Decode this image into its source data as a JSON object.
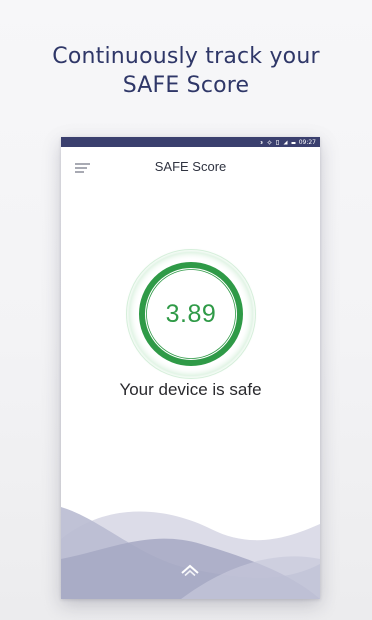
{
  "headline": {
    "line1": "Continuously track your",
    "line2": "SAFE Score"
  },
  "statusbar": {
    "time": "09:27"
  },
  "appbar": {
    "title": "SAFE Score",
    "menu_icon": "hamburger-menu-icon"
  },
  "score": {
    "value": "3.89",
    "ring_color": "#2f9a47",
    "halo_color": "#c9ecd0"
  },
  "status": {
    "message": "Your device is safe"
  },
  "colors": {
    "headline": "#2f3768",
    "statusbar": "#3a3f6e",
    "wave_light": "#d9d9e6",
    "wave_mid": "#b7b9cf",
    "wave_dark": "#a3a5c1"
  },
  "footer": {
    "swipe_icon": "chevron-up-icon"
  }
}
